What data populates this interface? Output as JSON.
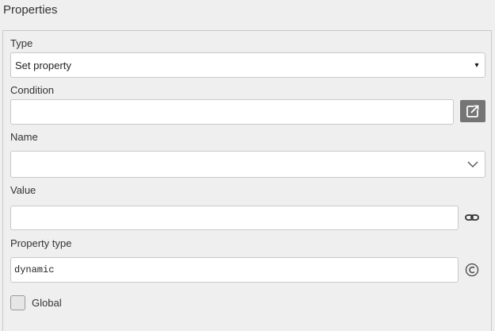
{
  "panel": {
    "title": "Properties"
  },
  "form": {
    "type": {
      "label": "Type",
      "value": "Set property",
      "arrow": "▾"
    },
    "condition": {
      "label": "Condition",
      "value": "",
      "button_icon": "external-link-icon"
    },
    "name": {
      "label": "Name",
      "value": "",
      "icon": "chevron-down-icon"
    },
    "value": {
      "label": "Value",
      "value": "",
      "icon": "link-icon"
    },
    "property_type": {
      "label": "Property type",
      "value": "dynamic",
      "icon": "copyright-icon"
    },
    "global": {
      "label": "Global",
      "checked": false
    }
  }
}
